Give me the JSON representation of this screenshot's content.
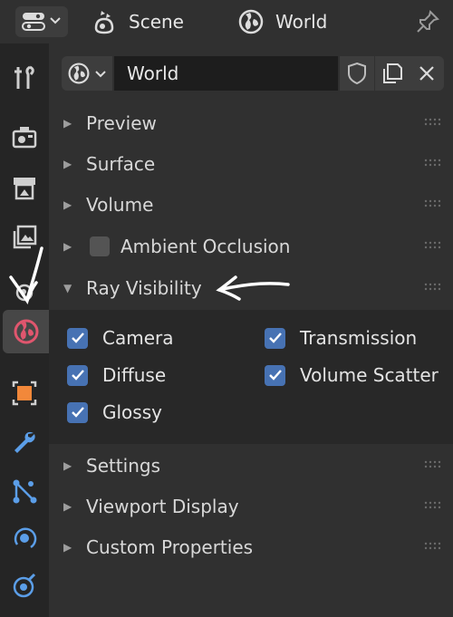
{
  "header": {
    "scene_label": "Scene",
    "world_label": "World",
    "icons": [
      "editor-type-icon",
      "chevron-down-icon",
      "scene-icon",
      "world-icon",
      "pin-icon"
    ]
  },
  "tabs": [
    {
      "name": "tool",
      "icon": "tool-icon"
    },
    {
      "name": "render",
      "icon": "render-icon"
    },
    {
      "name": "output",
      "icon": "output-icon"
    },
    {
      "name": "view-layer",
      "icon": "view-layer-icon"
    },
    {
      "name": "scene",
      "icon": "scene-icon"
    },
    {
      "name": "world",
      "icon": "world-icon",
      "active": true
    },
    {
      "name": "object",
      "icon": "object-icon"
    },
    {
      "name": "modifiers",
      "icon": "wrench-icon"
    },
    {
      "name": "particles",
      "icon": "particles-icon"
    },
    {
      "name": "physics",
      "icon": "physics-icon"
    },
    {
      "name": "constraints",
      "icon": "constraints-icon"
    }
  ],
  "datablock": {
    "name": "World"
  },
  "sections": {
    "preview": "Preview",
    "surface": "Surface",
    "volume": "Volume",
    "ambient_occlusion": "Ambient Occlusion",
    "ray_visibility": "Ray Visibility",
    "settings": "Settings",
    "viewport_display": "Viewport Display",
    "custom_properties": "Custom Properties"
  },
  "ambient_occlusion_enabled": false,
  "ray_visibility": {
    "camera": {
      "label": "Camera",
      "checked": true
    },
    "transmission": {
      "label": "Transmission",
      "checked": true
    },
    "diffuse": {
      "label": "Diffuse",
      "checked": true
    },
    "volume_scatter": {
      "label": "Volume Scatter",
      "checked": true
    },
    "glossy": {
      "label": "Glossy",
      "checked": true
    }
  },
  "colors": {
    "accent": "#4772b3",
    "world_tab": "#e0566e",
    "object_tab": "#f2883a",
    "modifier_tab": "#5b9ee8"
  }
}
